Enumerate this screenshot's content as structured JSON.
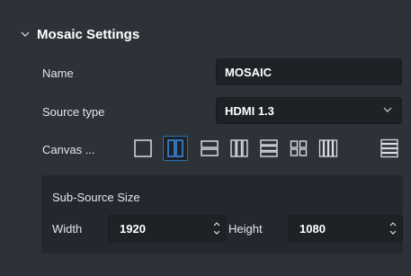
{
  "section": {
    "title": "Mosaic Settings",
    "expanded": true
  },
  "fields": {
    "name_label": "Name",
    "name_value": "MOSAIC",
    "source_type_label": "Source type",
    "source_type_value": "HDMI 1.3",
    "canvas_label": "Canvas ..."
  },
  "canvas_layouts": [
    {
      "name": "single",
      "selected": false
    },
    {
      "name": "split-vertical-2",
      "selected": true
    },
    {
      "name": "split-horizontal-2",
      "selected": false
    },
    {
      "name": "split-vertical-3",
      "selected": false
    },
    {
      "name": "split-horizontal-3",
      "selected": false
    },
    {
      "name": "grid-2x2",
      "selected": false
    },
    {
      "name": "split-vertical-4",
      "selected": false
    },
    {
      "name": "split-horizontal-4",
      "selected": false
    }
  ],
  "sub_source": {
    "title": "Sub-Source Size",
    "width_label": "Width",
    "width_value": "1920",
    "height_label": "Height",
    "height_value": "1080"
  },
  "colors": {
    "panel_bg": "#2d3138",
    "field_bg": "#1e2126",
    "accent": "#2b6fb6",
    "icon": "#d9dce0"
  }
}
